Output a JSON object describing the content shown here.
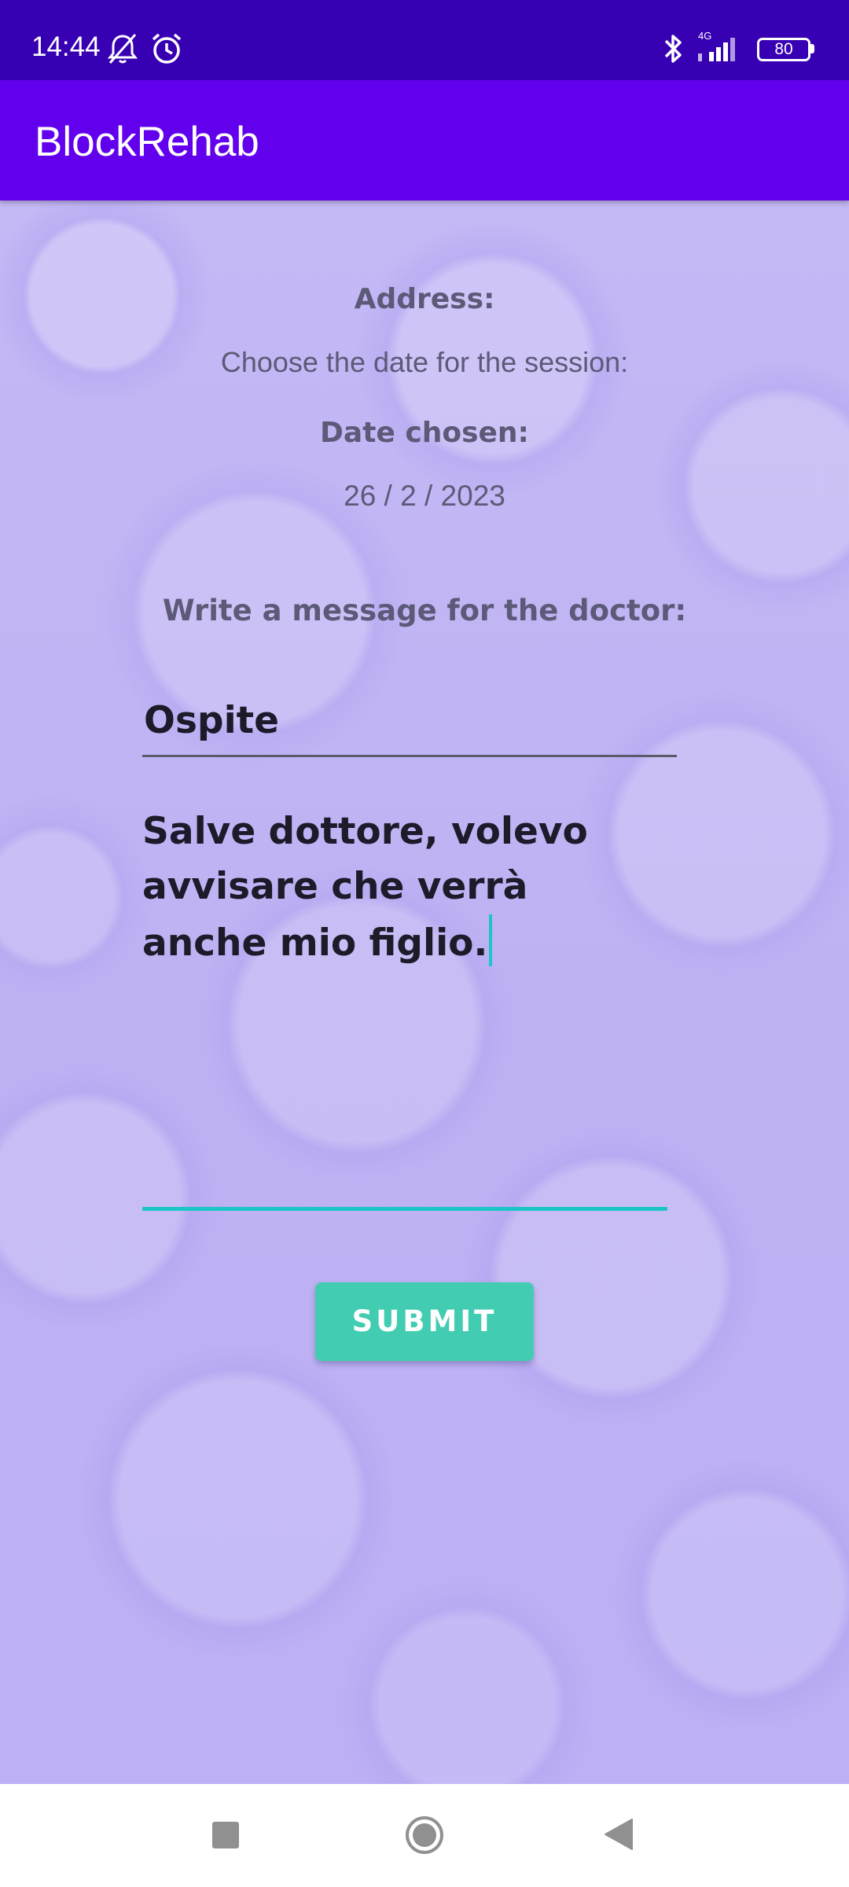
{
  "status_bar": {
    "time": "14:44",
    "network": "4G",
    "battery": "80",
    "icons": [
      "mute-alarm-icon",
      "alarm-icon",
      "bluetooth-icon",
      "signal-icon",
      "battery-icon"
    ]
  },
  "app_bar": {
    "title": "BlockRehab",
    "color": "#6200ee"
  },
  "form": {
    "address_label": "Address:",
    "choose_date_label": "Choose the date for the session:",
    "date_chosen_label": "Date chosen:",
    "date_value": "26 / 2 / 2023",
    "message_prompt": "Write a message for the doctor:",
    "name_value": "Ospite",
    "message_value": "Salve dottore, volevo\navvisare che verrà\nanche mio figlio.",
    "submit_label": "SUBMIT"
  },
  "colors": {
    "status_bar": "#3700b3",
    "accent": "#1dc6c6",
    "submit": "#42cdb2",
    "background": "#c3b6f4"
  },
  "nav_bar": {
    "icons": [
      "recents-icon",
      "home-icon",
      "back-icon"
    ]
  }
}
